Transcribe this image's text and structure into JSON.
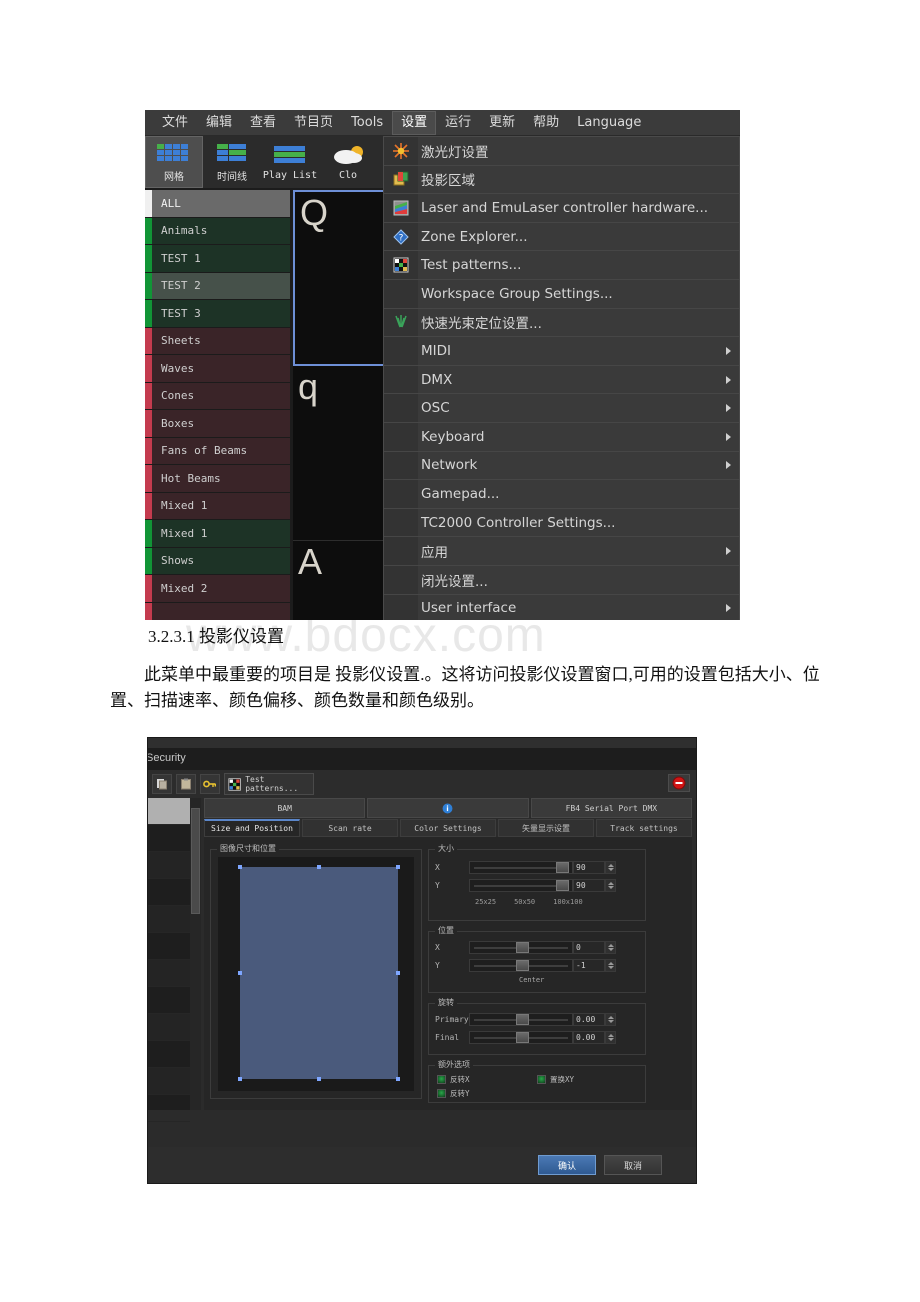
{
  "watermark": "www.bdocx.com",
  "app": {
    "menubar": [
      {
        "label": "文件",
        "active": false
      },
      {
        "label": "编辑",
        "active": false
      },
      {
        "label": "查看",
        "active": false
      },
      {
        "label": "节目页",
        "active": false
      },
      {
        "label": "Tools",
        "active": false
      },
      {
        "label": "设置",
        "active": true
      },
      {
        "label": "运行",
        "active": false
      },
      {
        "label": "更新",
        "active": false
      },
      {
        "label": "帮助",
        "active": false
      },
      {
        "label": "Language",
        "active": false
      }
    ],
    "toolbar": [
      {
        "label": "网格",
        "icon": "grid-icon",
        "selected": true
      },
      {
        "label": "时间线",
        "icon": "timeline-icon",
        "selected": false
      },
      {
        "label": "Play List",
        "icon": "playlist-icon",
        "selected": false
      },
      {
        "label": "Clo",
        "icon": "cloud-icon",
        "selected": false
      }
    ],
    "sidelist": [
      {
        "label": "ALL",
        "kind": "all"
      },
      {
        "label": "Animals",
        "kind": "green"
      },
      {
        "label": "TEST 1",
        "kind": "green"
      },
      {
        "label": "TEST 2",
        "kind": "green",
        "selected": true
      },
      {
        "label": "TEST 3",
        "kind": "green"
      },
      {
        "label": "Sheets",
        "kind": "red"
      },
      {
        "label": "Waves",
        "kind": "red"
      },
      {
        "label": "Cones",
        "kind": "red"
      },
      {
        "label": "Boxes",
        "kind": "red"
      },
      {
        "label": "Fans of Beams",
        "kind": "red"
      },
      {
        "label": "Hot Beams",
        "kind": "red"
      },
      {
        "label": "Mixed 1",
        "kind": "red"
      },
      {
        "label": "Mixed 1",
        "kind": "green"
      },
      {
        "label": "Shows",
        "kind": "green"
      },
      {
        "label": "Mixed 2",
        "kind": "red"
      },
      {
        "label": "",
        "kind": "red"
      }
    ],
    "grid_cells": [
      {
        "char": "Q",
        "selected": true
      },
      {
        "char": "q",
        "selected": false
      },
      {
        "char": "A",
        "selected": false
      }
    ],
    "dropdown": [
      {
        "label": "激光灯设置",
        "icon": "starburst-icon",
        "submenu": false
      },
      {
        "label": "投影区域",
        "icon": "projection-zone-icon",
        "submenu": false
      },
      {
        "label": "Laser and EmuLaser controller hardware...",
        "icon": "rainbow-square-icon",
        "submenu": false
      },
      {
        "label": "Zone Explorer...",
        "icon": "blue-diamond-help-icon",
        "submenu": false
      },
      {
        "label": "Test patterns...",
        "icon": "checker-pattern-icon",
        "submenu": false
      },
      {
        "label": "Workspace Group Settings...",
        "icon": "",
        "submenu": false
      },
      {
        "label": "快速光束定位设置...",
        "icon": "green-beams-icon",
        "submenu": false
      },
      {
        "label": "MIDI",
        "icon": "",
        "submenu": true
      },
      {
        "label": "DMX",
        "icon": "",
        "submenu": true
      },
      {
        "label": "OSC",
        "icon": "",
        "submenu": true
      },
      {
        "label": "Keyboard",
        "icon": "",
        "submenu": true
      },
      {
        "label": "Network",
        "icon": "",
        "submenu": true
      },
      {
        "label": "Gamepad...",
        "icon": "",
        "submenu": false
      },
      {
        "label": "TC2000 Controller Settings...",
        "icon": "",
        "submenu": false
      },
      {
        "label": "应用",
        "icon": "",
        "submenu": true
      },
      {
        "label": "闭光设置...",
        "icon": "",
        "submenu": false
      },
      {
        "label": "User interface",
        "icon": "",
        "submenu": true
      }
    ]
  },
  "document": {
    "heading": "3.2.3.1 投影仪设置",
    "paragraph": "此菜单中最重要的项目是 投影仪设置.。这将访问投影仪设置窗口,可用的设置包括大小、位置、扫描速率、颜色偏移、颜色数量和颜色级别。"
  },
  "dialog": {
    "security_label": "Security",
    "toolbar": {
      "test_patterns_label": "Test patterns..."
    },
    "top_tabs": [
      {
        "label": "BAM"
      },
      {
        "label": ""
      },
      {
        "label": "FB4 Serial Port DMX"
      }
    ],
    "sub_tabs": [
      {
        "label": "Size and Position",
        "active": true
      },
      {
        "label": "Scan rate",
        "active": false
      },
      {
        "label": "Color Settings",
        "active": false
      },
      {
        "label": "矢量显示设置",
        "active": false
      },
      {
        "label": "Track settings",
        "active": false
      }
    ],
    "preview": {
      "title": "图像尺寸和位置"
    },
    "size": {
      "title": "大小",
      "rows": [
        {
          "label": "X",
          "value": "90",
          "knob_pct": 88
        },
        {
          "label": "Y",
          "value": "90",
          "knob_pct": 88
        }
      ],
      "ticks": [
        "25x25",
        "50x50",
        "100x100"
      ]
    },
    "position": {
      "title": "位置",
      "rows": [
        {
          "label": "X",
          "value": "0",
          "knob_pct": 47
        },
        {
          "label": "Y",
          "value": "-1",
          "knob_pct": 47
        }
      ],
      "center_label": "Center"
    },
    "rotation": {
      "title": "旋转",
      "rows": [
        {
          "label": "Primary",
          "value": "0.00",
          "knob_pct": 47
        },
        {
          "label": "Final",
          "value": "0.00",
          "knob_pct": 47
        }
      ]
    },
    "extra": {
      "title": "额外选项",
      "checkboxes": [
        {
          "label": "反转X",
          "checked": true
        },
        {
          "label": "置换XY",
          "checked": true
        },
        {
          "label": "反转Y",
          "checked": true
        }
      ]
    },
    "footer": {
      "ok_label": "确认",
      "cancel_label": "取消"
    }
  }
}
